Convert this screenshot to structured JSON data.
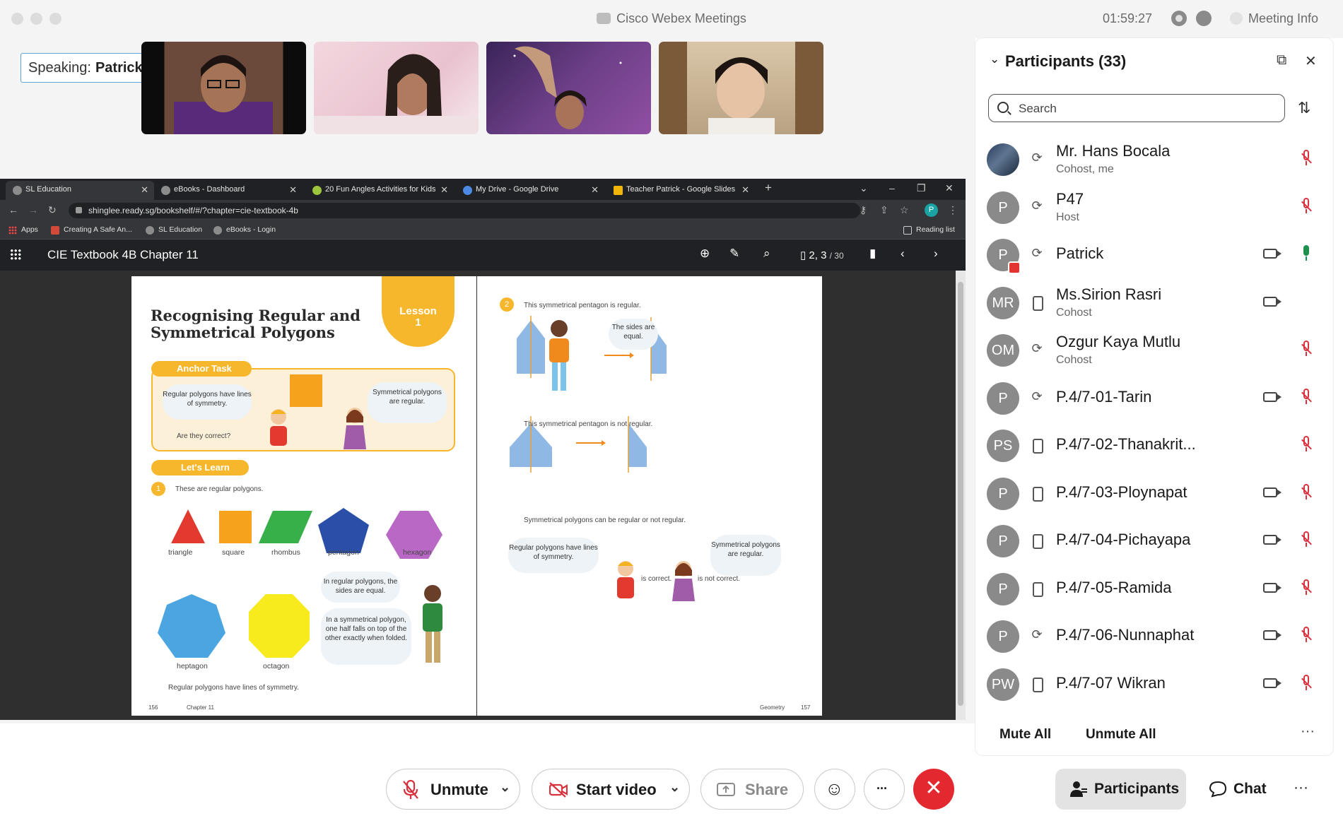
{
  "window": {
    "app_title": "Cisco Webex Meetings",
    "clock": "01:59:27",
    "meeting_info": "Meeting Info"
  },
  "speaking": {
    "label": "Speaking:",
    "name": "Patrick"
  },
  "browser": {
    "tabs": [
      {
        "title": "SL Education",
        "active": true
      },
      {
        "title": "eBooks - Dashboard"
      },
      {
        "title": "20 Fun Angles Activities for Kids"
      },
      {
        "title": "My Drive - Google Drive"
      },
      {
        "title": "Teacher Patrick - Google Slides"
      }
    ],
    "url": "shinglee.ready.sg/bookshelf/#/?chapter=cie-textbook-4b",
    "bookmarks": [
      "Apps",
      "Creating A Safe An...",
      "SL Education",
      "eBooks - Login"
    ],
    "reading_list": "Reading list",
    "avatar_letter": "P"
  },
  "reader": {
    "book_title": "CIE Textbook 4B Chapter 11",
    "page_indicator": "2, 3",
    "page_total": "/ 30"
  },
  "textbook": {
    "left": {
      "heading_line1": "Recognising Regular and",
      "heading_line2": "Symmetrical Polygons",
      "lesson_label": "Lesson",
      "lesson_number": "1",
      "anchor_task": "Anchor Task",
      "bubble_a": "Regular polygons have lines of symmetry.",
      "bubble_b": "Symmetrical polygons are regular.",
      "question": "Are they correct?",
      "lets_learn": "Let's Learn",
      "intro": "These are regular polygons.",
      "shapes": [
        "triangle",
        "square",
        "rhombus",
        "pentagon",
        "hexagon",
        "heptagon",
        "octagon"
      ],
      "bubble_c": "In regular polygons, the sides are equal.",
      "bubble_d": "In a symmetrical polygon, one half falls on top of the other exactly when folded.",
      "footnote": "Regular polygons have lines of symmetry.",
      "page_no": "156",
      "chapter": "Chapter 11"
    },
    "right": {
      "step": "2",
      "line1": "This symmetrical pentagon is regular.",
      "bubble_sides": "The sides are equal.",
      "line2": "This symmetrical pentagon is not regular.",
      "line3": "Symmetrical polygons can be regular or not regular.",
      "bubble_e": "Regular polygons have lines of symmetry.",
      "bubble_f": "Symmetrical polygons are regular.",
      "correct": "is correct.",
      "not_correct": "is not correct.",
      "section": "Geometry",
      "page_no": "157"
    }
  },
  "participants": {
    "title": "Participants (33)",
    "search_placeholder": "Search",
    "list": [
      {
        "name": "Mr. Hans Bocala",
        "role": "Cohost, me",
        "avatar": "",
        "conn": "headset",
        "video": false,
        "mic": "muted"
      },
      {
        "name": "P47",
        "role": "Host",
        "avatar": "P",
        "conn": "headset",
        "video": false,
        "mic": "muted"
      },
      {
        "name": "Patrick",
        "role": "",
        "avatar": "P",
        "conn": "headset",
        "video": true,
        "mic": "active"
      },
      {
        "name": "Ms.Sirion Rasri",
        "role": "Cohost",
        "avatar": "MR",
        "conn": "phone",
        "video": true,
        "mic": "none"
      },
      {
        "name": "Ozgur Kaya Mutlu",
        "role": "Cohost",
        "avatar": "OM",
        "conn": "headset",
        "video": false,
        "mic": "muted"
      },
      {
        "name": "P.4/7-01-Tarin",
        "role": "",
        "avatar": "P",
        "conn": "headset",
        "video": true,
        "mic": "muted"
      },
      {
        "name": "P.4/7-02-Thanakrit...",
        "role": "",
        "avatar": "PS",
        "conn": "phone",
        "video": false,
        "mic": "muted"
      },
      {
        "name": "P.4/7-03-Ploynapat",
        "role": "",
        "avatar": "P",
        "conn": "phone",
        "video": true,
        "mic": "muted"
      },
      {
        "name": "P.4/7-04-Pichayapa",
        "role": "",
        "avatar": "P",
        "conn": "phone",
        "video": true,
        "mic": "muted"
      },
      {
        "name": "P.4/7-05-Ramida",
        "role": "",
        "avatar": "P",
        "conn": "phone",
        "video": true,
        "mic": "muted"
      },
      {
        "name": "P.4/7-06-Nunnaphat",
        "role": "",
        "avatar": "P",
        "conn": "headset",
        "video": true,
        "mic": "muted"
      },
      {
        "name": "P.4/7-07 Wikran",
        "role": "",
        "avatar": "PW",
        "conn": "phone",
        "video": true,
        "mic": "muted"
      }
    ],
    "mute_all": "Mute All",
    "unmute_all": "Unmute All"
  },
  "controls": {
    "unmute": "Unmute",
    "start_video": "Start video",
    "share": "Share",
    "more": "...",
    "participants_tab": "Participants",
    "chat_tab": "Chat"
  },
  "colors": {
    "end_call": "#e3282f",
    "muted_mic": "#d9323f",
    "active_mic": "#1f8f4d",
    "speaking_border": "#5da3d8"
  }
}
